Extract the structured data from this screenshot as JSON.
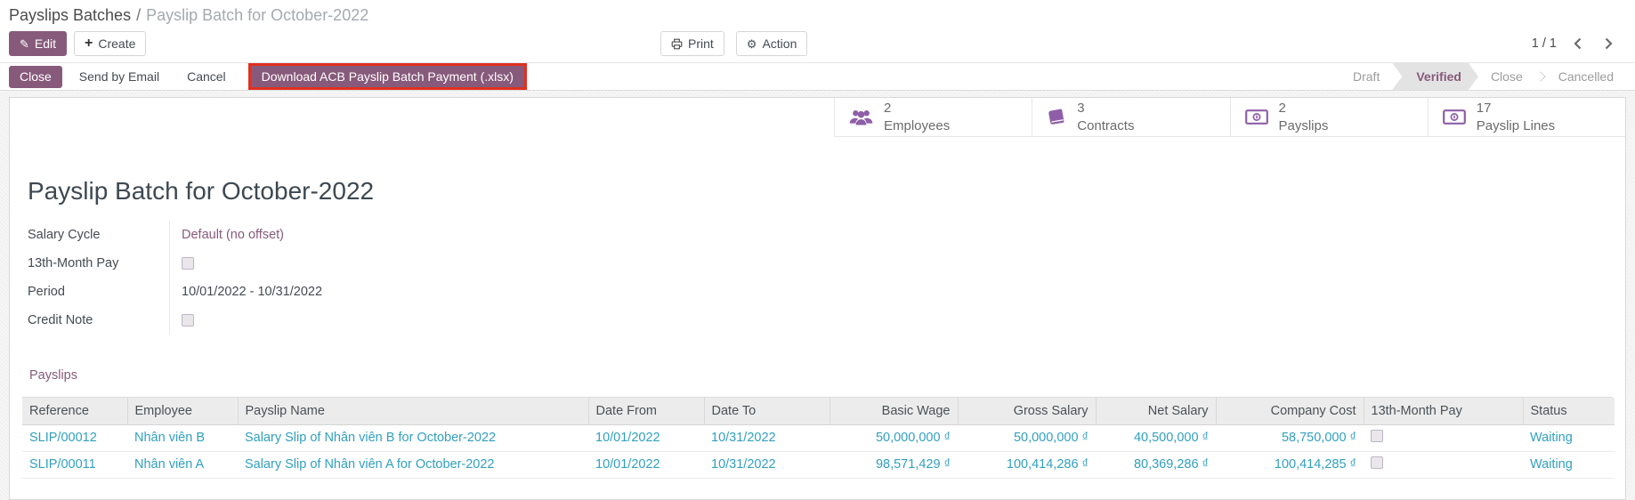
{
  "breadcrumb": {
    "parent": "Payslips Batches",
    "separator": "/",
    "current": "Payslip Batch for October-2022"
  },
  "actions": {
    "edit": "Edit",
    "create": "Create",
    "print": "Print",
    "action": "Action"
  },
  "pager": {
    "value": "1 / 1"
  },
  "statusbar": {
    "buttons": [
      {
        "label": "Close",
        "style": "primary"
      },
      {
        "label": "Send by Email",
        "style": "plain"
      },
      {
        "label": "Cancel",
        "style": "plain"
      },
      {
        "label": "Download ACB Payslip Batch Payment (.xlsx)",
        "style": "primary",
        "highlighted": true
      }
    ],
    "states": [
      {
        "label": "Draft",
        "active": false
      },
      {
        "label": "Verified",
        "active": true
      },
      {
        "label": "Close",
        "active": false
      },
      {
        "label": "Cancelled",
        "active": false
      }
    ]
  },
  "stats": [
    {
      "icon": "users-icon",
      "value": "2",
      "label": "Employees"
    },
    {
      "icon": "book-icon",
      "value": "3",
      "label": "Contracts"
    },
    {
      "icon": "money-icon",
      "value": "2",
      "label": "Payslips"
    },
    {
      "icon": "money-icon",
      "value": "17",
      "label": "Payslip Lines"
    }
  ],
  "form": {
    "title": "Payslip Batch for October-2022",
    "fields": [
      {
        "label": "Salary Cycle",
        "value": "Default (no offset)",
        "type": "link"
      },
      {
        "label": "13th-Month Pay",
        "type": "checkbox",
        "checked": false
      },
      {
        "label": "Period",
        "value": "10/01/2022 - 10/31/2022",
        "type": "text"
      },
      {
        "label": "Credit Note",
        "type": "checkbox",
        "checked": false
      }
    ]
  },
  "notebook": {
    "active_tab": "Payslips"
  },
  "table": {
    "columns": [
      "Reference",
      "Employee",
      "Payslip Name",
      "Date From",
      "Date To",
      "Basic Wage",
      "Gross Salary",
      "Net Salary",
      "Company Cost",
      "13th-Month Pay",
      "Status"
    ],
    "rows": [
      {
        "cells": [
          "SLIP/00012",
          "Nhân viên B",
          "Salary Slip of Nhân viên B for October-2022",
          "10/01/2022",
          "10/31/2022",
          "50,000,000 ₫",
          "50,000,000 ₫",
          "40,500,000 ₫",
          "58,750,000 ₫"
        ],
        "thirteenth_month_checked": false,
        "status": "Waiting"
      },
      {
        "cells": [
          "SLIP/00011",
          "Nhân viên A",
          "Salary Slip of Nhân viên A for October-2022",
          "10/01/2022",
          "10/31/2022",
          "98,571,429 ₫",
          "100,414,286 ₫",
          "80,369,286 ₫",
          "100,414,285 ₫"
        ],
        "thirteenth_month_checked": false,
        "status": "Waiting"
      }
    ]
  },
  "icons": {
    "edit": "pencil-icon",
    "create": "plus-icon",
    "print": "printer-icon",
    "action": "gear-icon",
    "pager_previous": "chevron-left-icon",
    "pager_next": "chevron-right-icon",
    "stats": [
      "users-icon",
      "book-icon",
      "money-icon",
      "money-icon"
    ]
  },
  "colors": {
    "primary_purple": "#875A7B",
    "stat_icon_purple": "#8e5fa8",
    "highlight_red": "#e0301e",
    "table_link_teal": "#31a0bf",
    "state_active_bg": "#e3e3e3"
  }
}
